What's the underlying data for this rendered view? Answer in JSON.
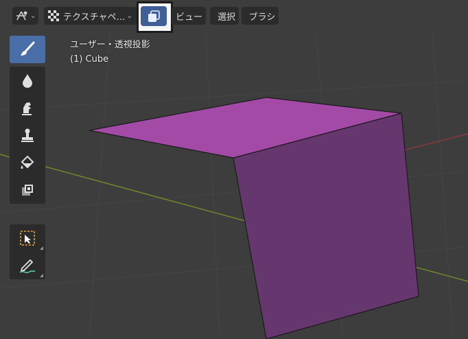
{
  "header": {
    "mode_icon": "texture-paint-mode-icon",
    "texture_label": "テクスチャペ…",
    "slots_icon": "texture-slots-icon",
    "menus": {
      "view": "ビュー",
      "select": "選択",
      "brush": "ブラシ"
    }
  },
  "viewport": {
    "view_name": "ユーザー・透視投影",
    "object_name": "(1) Cube",
    "object_color": "#a24aa6"
  },
  "toolbar": {
    "tools": [
      {
        "name": "draw-tool",
        "icon": "brush-icon",
        "active": true
      },
      {
        "name": "soften-tool",
        "icon": "drop-icon",
        "active": false
      },
      {
        "name": "smear-tool",
        "icon": "finger-icon",
        "active": false
      },
      {
        "name": "clone-tool",
        "icon": "stamp-icon",
        "active": false
      },
      {
        "name": "fill-tool",
        "icon": "paint-bucket-icon",
        "active": false
      },
      {
        "name": "mask-tool",
        "icon": "mask-icon",
        "active": false
      },
      {
        "name": "select-box-tool",
        "icon": "select-box-icon",
        "active": false
      },
      {
        "name": "annotate-tool",
        "icon": "annotate-pencil-icon",
        "active": false
      }
    ]
  },
  "colors": {
    "background": "#3d3d3d",
    "panel": "#2b2b2b",
    "accent": "#4a6fa8",
    "axis_x": "#8a3b3b",
    "axis_y": "#6e8a2a"
  }
}
